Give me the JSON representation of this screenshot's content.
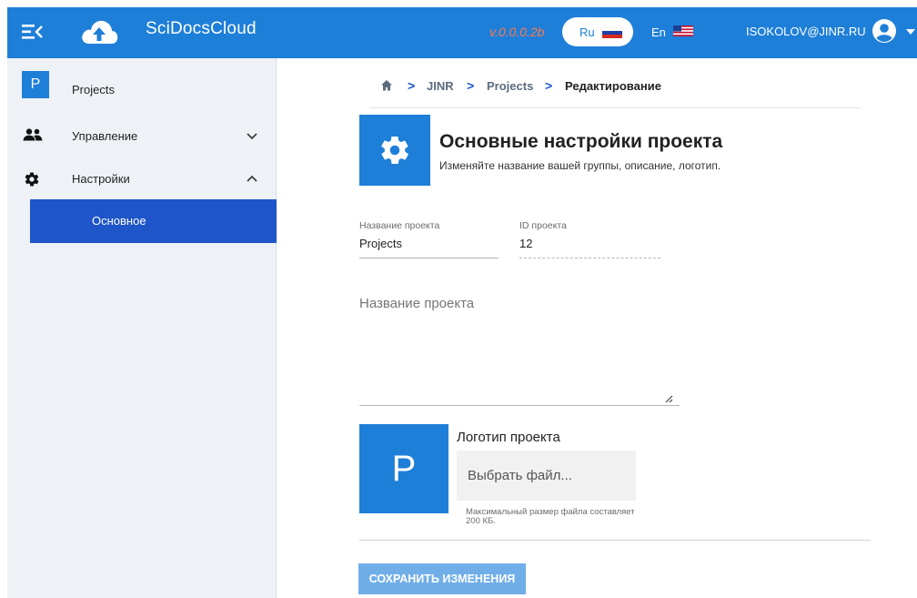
{
  "header": {
    "brand": "SciDocsCloud",
    "version": "v.0.0.0.2b",
    "lang_ru": "Ru",
    "lang_en": "En",
    "user_email": "ISOKOLOV@JINR.RU",
    "icons": [
      "menu-collapse-icon",
      "cloud-upload-icon",
      "russia-flag-icon",
      "usa-flag-icon",
      "user-account-icon",
      "caret-down-icon"
    ]
  },
  "sidebar": {
    "project_badge": "P",
    "project_label": "Projects",
    "management_label": "Управление",
    "settings_label": "Настройки",
    "sub_general_label": "Основное",
    "icons": [
      "people-icon",
      "gear-icon",
      "chevron-down-icon",
      "chevron-up-icon"
    ]
  },
  "breadcrumb": {
    "items": [
      "JINR",
      "Projects"
    ],
    "current": "Редактирование",
    "separator": ">"
  },
  "page": {
    "title": "Основные настройки проекта",
    "subtitle": "Изменяйте название вашей группы, описание, логотип."
  },
  "form": {
    "name_label": "Название проекта",
    "name_value": "Projects",
    "id_label": "ID проекта",
    "id_value": "12",
    "description_placeholder": "Название проекта",
    "logo_title": "Логотип проекта",
    "logo_letter": "P",
    "file_button": "Выбрать файл...",
    "file_hint": "Максимальный размер файла составляет 200 КБ.",
    "save_button": "СОХРАНИТЬ ИЗМЕНЕНИЯ"
  },
  "colors": {
    "primary": "#1e7fd8",
    "active_nav": "#1e55c8",
    "version": "#ff7a4a",
    "save_disabled": "#70aee8"
  }
}
